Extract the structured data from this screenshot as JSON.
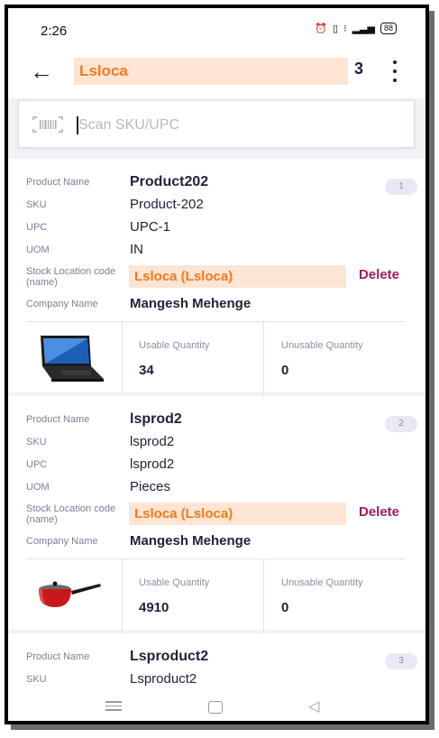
{
  "status_bar": {
    "time": "2:26",
    "battery": "88"
  },
  "header": {
    "title": "Lsloca",
    "count": "3",
    "accent": "#f07b1f"
  },
  "search": {
    "placeholder": "Scan SKU/UPC"
  },
  "labels": {
    "product_name": "Product Name",
    "sku": "SKU",
    "upc": "UPC",
    "uom": "UOM",
    "stock_location": "Stock Location code (name)",
    "company_name": "Company Name",
    "usable_quantity": "Usable Quantity",
    "unusable_quantity": "Unusable Quantity",
    "delete": "Delete"
  },
  "products": [
    {
      "index": "1",
      "name": "Product202",
      "sku": "Product-202",
      "upc": "UPC-1",
      "uom": "IN",
      "stock_location": "Lsloca (Lsloca)",
      "company": "Mangesh Mehenge",
      "image": "laptop",
      "usable": "34",
      "unusable": "0"
    },
    {
      "index": "2",
      "name": "lsprod2",
      "sku": "lsprod2",
      "upc": "lsprod2",
      "uom": "Pieces",
      "stock_location": "Lsloca (Lsloca)",
      "company": "Mangesh Mehenge",
      "image": "saucepan",
      "usable": "4910",
      "unusable": "0"
    },
    {
      "index": "3",
      "name": "Lsproduct2",
      "sku": "Lsproduct2"
    }
  ],
  "colors": {
    "location_bg": "#fde5d3",
    "delete": "#a01d5c",
    "badge_bg": "#e8e9f4"
  }
}
